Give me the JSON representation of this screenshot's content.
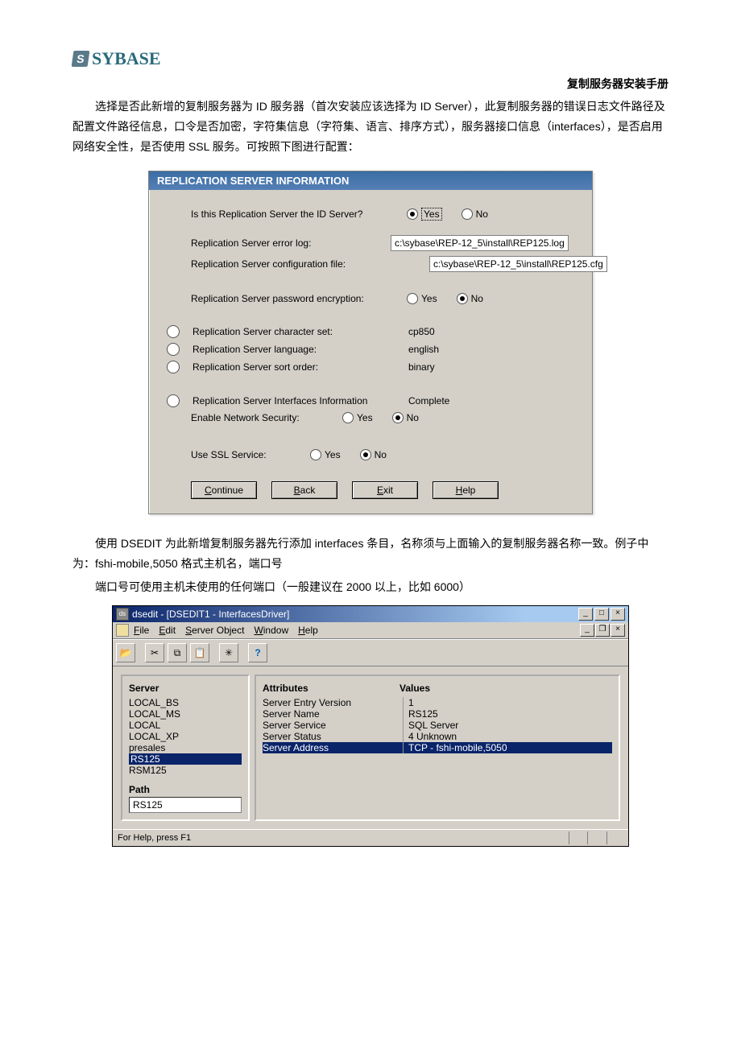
{
  "logo_text": "SYBASE",
  "doc_title": "复制服务器安装手册",
  "intro_p1": "选择是否此新增的复制服务器为 ID 服务器（首次安装应该选择为 ID Server），此复制服务器的错误日志文件路径及配置文件路径信息，口令是否加密，字符集信息（字符集、语言、排序方式），服务器接口信息（interfaces），是否启用网络安全性，是否使用 SSL 服务。可按照下图进行配置：",
  "panel": {
    "title": "REPLICATION SERVER INFORMATION",
    "q_id_server": "Is this Replication Server the ID Server?",
    "yes": "Yes",
    "no": "No",
    "err_log_label": "Replication Server error log:",
    "err_log_value": "c:\\sybase\\REP-12_5\\install\\REP125.log",
    "cfg_label": "Replication Server configuration file:",
    "cfg_value": "c:\\sybase\\REP-12_5\\install\\REP125.cfg",
    "pwd_enc_label": "Replication Server password encryption:",
    "charset_label": "Replication Server character set:",
    "charset_value": "cp850",
    "lang_label": "Replication Server language:",
    "lang_value": "english",
    "sort_label": "Replication Server sort order:",
    "sort_value": "binary",
    "iface_label": "Replication Server Interfaces Information",
    "iface_value": "Complete",
    "net_sec_label": "Enable Network Security:",
    "ssl_label": "Use SSL Service:",
    "btn_continue_u": "C",
    "btn_continue": "ontinue",
    "btn_back_u": "B",
    "btn_back": "ack",
    "btn_exit_u": "E",
    "btn_exit": "xit",
    "btn_help_u": "H",
    "btn_help": "elp"
  },
  "para2": "使用 DSEDIT 为此新增复制服务器先行添加 interfaces 条目，名称须与上面输入的复制服务器名称一致。例子中为：fshi-mobile,5050    格式主机名，端口号",
  "para3": "端口号可使用主机未使用的任何端口（一般建议在 2000 以上，比如 6000）",
  "dsedit": {
    "title": "dsedit - [DSEDIT1 - InterfacesDriver]",
    "menu": {
      "file": "File",
      "edit": "Edit",
      "server": "Server Object",
      "window": "Window",
      "help": "Help"
    },
    "server_label": "Server",
    "servers": [
      "LOCAL_BS",
      "LOCAL_MS",
      "LOCAL",
      "LOCAL_XP",
      "presales",
      "RS125",
      "RSM125"
    ],
    "attrs_label": "Attributes",
    "values_label": "Values",
    "rows": [
      {
        "a": "Server Entry Version",
        "v": "1"
      },
      {
        "a": "Server Name",
        "v": "RS125"
      },
      {
        "a": "Server Service",
        "v": "SQL Server"
      },
      {
        "a": "Server Status",
        "v": "4   Unknown"
      },
      {
        "a": "Server Address",
        "v": "TCP - fshi-mobile,5050"
      }
    ],
    "path_label": "Path",
    "path_value": "RS125",
    "status": "For Help, press F1"
  }
}
